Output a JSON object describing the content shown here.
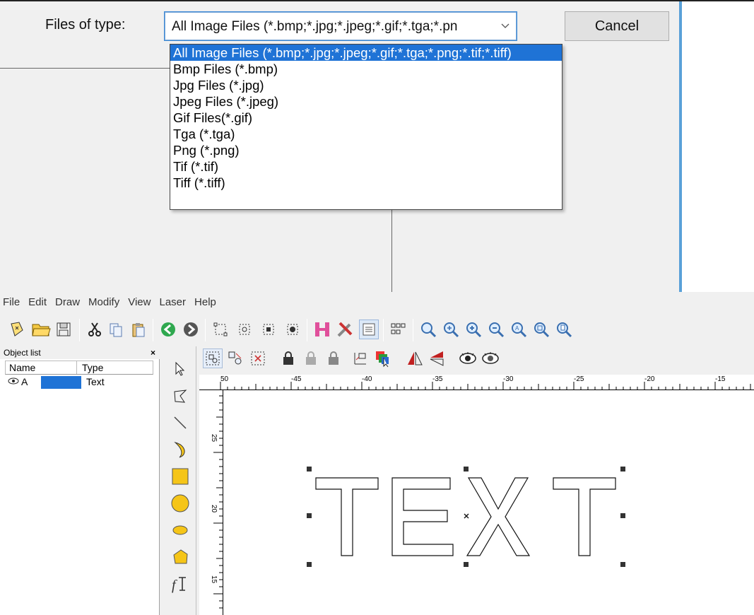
{
  "dialog": {
    "file_type_label": "Files of type:",
    "file_type_value": "All Image Files (*.bmp;*.jpg;*.jpeg;*.gif;*.tga;*.pn",
    "cancel_label": "Cancel",
    "options": [
      "All Image Files (*.bmp;*.jpg;*.jpeg;*.gif;*.tga;*.png;*.tif;*.tiff)",
      "Bmp Files (*.bmp)",
      "Jpg Files (*.jpg)",
      "Jpeg Files (*.jpeg)",
      "Gif Files(*.gif)",
      "Tga (*.tga)",
      "Png (*.png)",
      "Tif (*.tif)",
      "Tiff (*.tiff)"
    ]
  },
  "menu": [
    "File",
    "Edit",
    "Draw",
    "Modify",
    "View",
    "Laser",
    "Help"
  ],
  "object_list": {
    "title": "Object list",
    "close": "×",
    "col_name": "Name",
    "col_type": "Type",
    "rows": [
      {
        "name": "A",
        "type": "Text"
      }
    ]
  },
  "ruler": {
    "top_labels": [
      "50",
      "-45",
      "-40",
      "-35",
      "-30",
      "-25",
      "-20",
      "-15"
    ],
    "left_labels": [
      "25",
      "20",
      "15"
    ]
  },
  "canvas": {
    "text": "TEXT"
  },
  "colors": {
    "accent": "#1f73d6",
    "dialog_bg": "#f0f0f0"
  }
}
